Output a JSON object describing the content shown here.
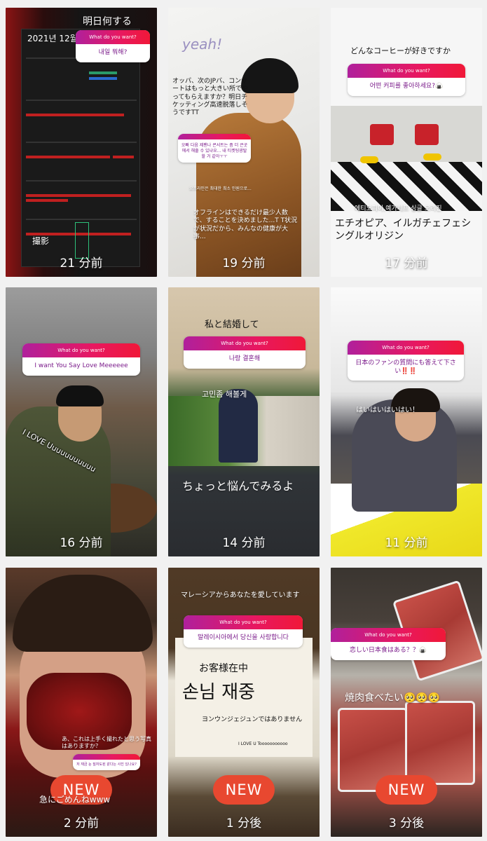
{
  "tiles": [
    {
      "time": "21 分前",
      "caption_top": "明日何する",
      "calendar_header": "2021년 12월",
      "caption_bottom": "撮影",
      "question": {
        "header": "What do you want?",
        "body": "내일 뭐해?"
      }
    },
    {
      "time": "19 分前",
      "caption_logo": "yeah!",
      "caption_top": "オッパ、次のJPバ、コンサートはもっと大きい所でやってもらえますか？明日チケッティング高速脱落しそうですTT",
      "question": {
        "header": "",
        "body": "오빠 다음 제팬나 콘서트는 좀 더 큰곳에서 해줄 수 있냐요... 내 티켓팅광탈할 거 같아ㅜㅜ"
      },
      "caption_korean": "오프라인은 최대한 최소 인원으로...",
      "caption_bottom": "オフラインはできるだけ最少人数で、することを決めました...T T状況が状況だから、みんなの健康が大事..."
    },
    {
      "time": "17 分前",
      "caption_top": "どんなコーヒーが好きですか",
      "question": {
        "header": "What do you want?",
        "body": "어떤 커피를 좋아하세요?🍙"
      },
      "caption_korean": "에티오피아,예가체프 싱글 오리진",
      "caption_bottom": "エチオピア、イルガチェフェシングルオリジン"
    },
    {
      "time": "16 分前",
      "question": {
        "header": "What do you want?",
        "body": "I want You Say Love Meeeeee"
      },
      "caption_bottom": "I LOVE Uuuuuuuuuuu"
    },
    {
      "time": "14 分前",
      "caption_top": "私と結婚して",
      "question": {
        "header": "What do you want?",
        "body": "나랑 결혼해"
      },
      "caption_korean": "고민좀 해볼게",
      "caption_bottom": "ちょっと悩んでみるよ"
    },
    {
      "time": "11 分前",
      "question": {
        "header": "What do you want?",
        "body": "日本のファンの質問にも答えて下さい‼️‼️"
      },
      "caption_bottom": "はいはいはいはい！"
    },
    {
      "time": "2 分前",
      "new_label": "NEW",
      "question": {
        "header": "",
        "body": "저 재금 눈 질자도된 같다는 사진 있나요?"
      },
      "caption_top": "あ、これは上手く撮れたと思う写真はありますか？",
      "caption_bottom": "急にごめんねwww"
    },
    {
      "time": "1 分後",
      "new_label": "NEW",
      "caption_top": "マレーシアからあなたを愛しています",
      "question": {
        "header": "What do you want?",
        "body": "말레이시아에서 당신을 사랑합니다"
      },
      "sign_line1": "お客様在中",
      "sign_line2": "손님 재중",
      "caption_bottom": "ヨンウンジェジュンではありません",
      "caption_small": "I LOVE U Tooooooooooo"
    },
    {
      "time": "3 分後",
      "new_label": "NEW",
      "question": {
        "header": "What do you want?",
        "body": "恋しい日本食はある？？🍙"
      },
      "caption_bottom": "焼肉食べたい🥺🥺🥺"
    }
  ]
}
